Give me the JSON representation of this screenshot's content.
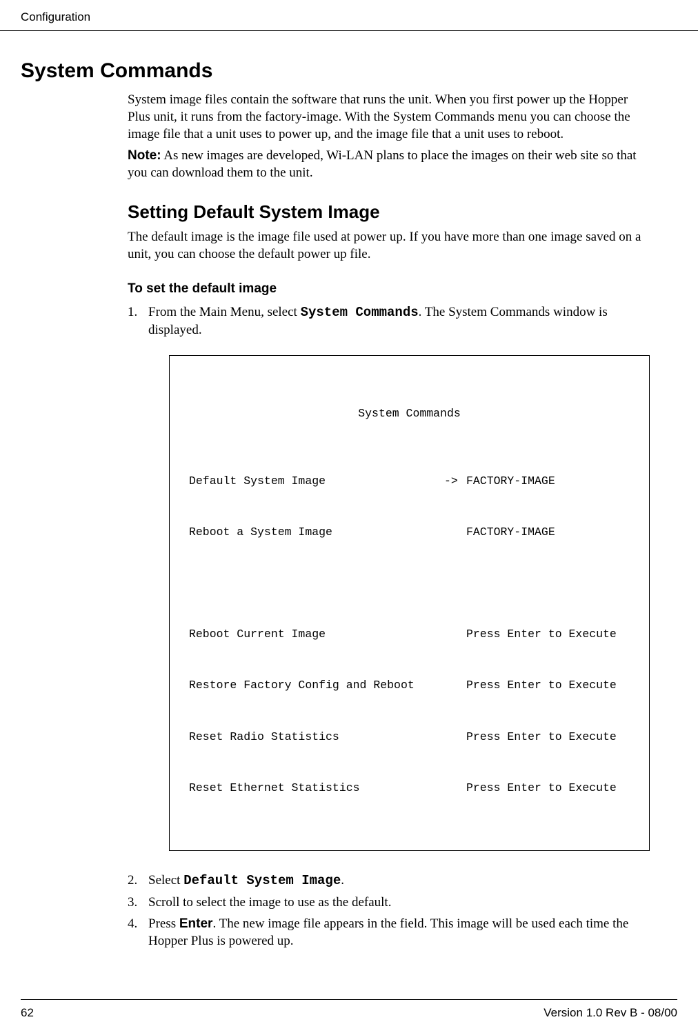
{
  "header": {
    "section_name": "Configuration"
  },
  "heading_main": "System Commands",
  "para_intro": "System image files contain the software that runs the unit. When you first power up the Hopper Plus unit, it runs from the factory-image. With the System Commands menu you can choose the image file that a unit uses to power up, and the image file that a unit uses to reboot.",
  "note_label": "Note:",
  "para_note": " As new images are developed, Wi-LAN plans to place the images on their web site so that you can download them to the unit.",
  "heading_sub": "Setting Default System Image",
  "para_sub": "The default image is the image file used at power up. If you have more than one image saved on a unit, you can choose the default power up file.",
  "heading_task": "To set the default image",
  "step1_pre": "From the Main Menu",
  "step1_italic_comma": ",",
  "step1_mid": " select ",
  "step1_cmd": "System Commands",
  "step1_post": ". The System Commands window is displayed.",
  "screen": {
    "title": "System Commands",
    "rows": [
      {
        "label": "Default System Image",
        "arrow": "->",
        "value": "FACTORY-IMAGE"
      },
      {
        "label": "Reboot a System Image",
        "arrow": "",
        "value": "FACTORY-IMAGE"
      }
    ],
    "rows2": [
      {
        "label": "Reboot Current Image",
        "arrow": "",
        "value": "Press Enter to Execute"
      },
      {
        "label": "Restore Factory Config and Reboot",
        "arrow": "",
        "value": "Press Enter to Execute"
      },
      {
        "label": "Reset Radio Statistics",
        "arrow": "",
        "value": "Press Enter to Execute"
      },
      {
        "label": "Reset Ethernet Statistics",
        "arrow": "",
        "value": "Press Enter to Execute"
      }
    ]
  },
  "step2_pre": "Select ",
  "step2_cmd": "Default System Image",
  "step2_post": ".",
  "step3": "Scroll to select the image to use as the default.",
  "step4_pre": "Press ",
  "step4_cmd": "Enter",
  "step4_post": ". The new image file appears in the field. This image will be used each time the Hopper Plus is powered up.",
  "footer": {
    "page_number": "62",
    "version": "Version 1.0 Rev B - 08/00"
  }
}
